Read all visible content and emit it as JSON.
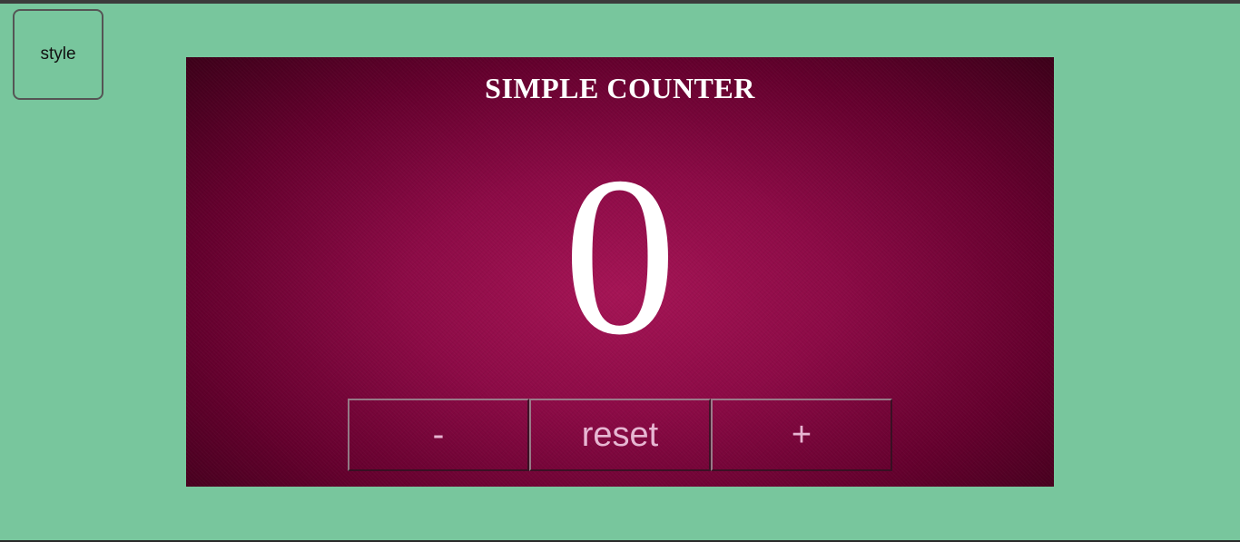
{
  "style_button": {
    "label": "style"
  },
  "counter": {
    "title": "SIMPLE COUNTER",
    "value": "0",
    "buttons": {
      "decrement": "-",
      "reset": "reset",
      "increment": "+"
    }
  },
  "colors": {
    "page_background": "#78c69d",
    "panel_accent": "#8c0a46",
    "text_primary": "#ffffff",
    "button_text": "#e7b6d2"
  }
}
